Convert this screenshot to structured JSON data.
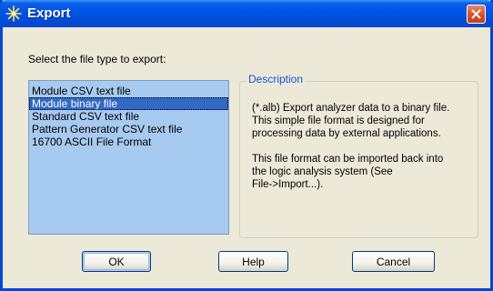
{
  "window": {
    "title": "Export",
    "accent_color": "#0055e5",
    "close_color": "#d9532b"
  },
  "prompt": "Select the file type to export:",
  "file_types": {
    "selected_index": 1,
    "items": [
      "Module CSV text file",
      "Module binary file",
      "Standard CSV text file",
      "Pattern Generator CSV text file",
      "16700 ASCII File Format"
    ]
  },
  "description": {
    "legend": "Description",
    "paragraph1_lines": [
      " (*.alb) Export analyzer data to a binary file.",
      " This simple file format is designed for",
      " processing data by external applications."
    ],
    "paragraph2_lines": [
      "This file format can be imported back into",
      "the logic analysis system (See",
      "File->Import...)."
    ]
  },
  "buttons": {
    "ok": "OK",
    "help": "Help",
    "cancel": "Cancel"
  },
  "icons": {
    "title": "export-star-icon",
    "close": "close-icon"
  }
}
